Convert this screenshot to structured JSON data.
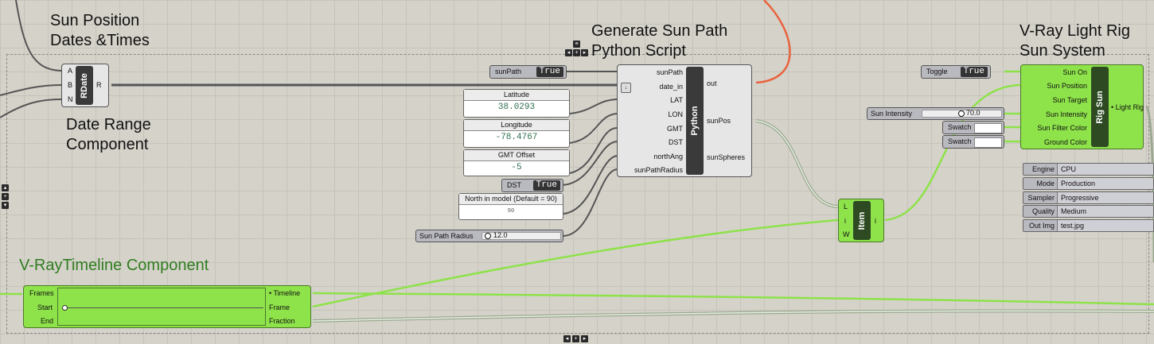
{
  "labels": {
    "sun_position": "Sun Position\nDates &Times",
    "date_range": "Date Range\nComponent",
    "generate_sun_path": "Generate Sun Path\nPython Script",
    "vray_light_rig": "V-Ray Light Rig\nSun System",
    "vray_timeline": "V-RayTimeline Component"
  },
  "rdate": {
    "name": "RDate",
    "inputs": [
      "A",
      "B",
      "N"
    ],
    "outputs": [
      "R"
    ]
  },
  "toggle_sunpath": {
    "name": "sunPath",
    "value": "True"
  },
  "toggle_dst": {
    "name": "DST",
    "value": "True"
  },
  "toggle_sun": {
    "name": "Toggle",
    "value": "True"
  },
  "panel_lat": {
    "header": "Latitude",
    "value": "38.0293"
  },
  "panel_lon": {
    "header": "Longitude",
    "value": "-78.4767"
  },
  "panel_gmt": {
    "header": "GMT Offset",
    "value": "-5"
  },
  "panel_north": {
    "header": "North in model (Default = 90)",
    "value": "90"
  },
  "slider_sunpath_radius": {
    "name": "Sun Path Radius",
    "value": "12.0"
  },
  "slider_sun_intensity": {
    "name": "Sun Intensity",
    "value": "70.0"
  },
  "python": {
    "name": "Python",
    "inputs": [
      "sunPath",
      "date_in",
      "LAT",
      "LON",
      "GMT",
      "DST",
      "northAng",
      "sunPathRadius"
    ],
    "outputs": [
      "out",
      "sunPos",
      "sunSpheres"
    ]
  },
  "item": {
    "name": "Item",
    "inputs": [
      "L",
      "i",
      "W"
    ],
    "outputs": [
      "i"
    ]
  },
  "rig_sun": {
    "name": "Rig Sun",
    "inputs": [
      "Sun On",
      "Sun Position",
      "Sun Target",
      "Sun Intensity",
      "Sun Filter Color",
      "Ground Color"
    ],
    "outputs": [
      "Light Rig"
    ]
  },
  "swatch_1": {
    "name": "Swatch"
  },
  "swatch_2": {
    "name": "Swatch"
  },
  "vray_settings": [
    {
      "key": "Engine",
      "value": "CPU"
    },
    {
      "key": "Mode",
      "value": "Production"
    },
    {
      "key": "Sampler",
      "value": "Progressive"
    },
    {
      "key": "Quality",
      "value": "Medium"
    },
    {
      "key": "Out Img",
      "value": "test.jpg"
    }
  ],
  "timeline": {
    "inputs": [
      "Frames",
      "Start",
      "End"
    ],
    "outputs": [
      "Timeline",
      "Frame",
      "Fraction"
    ]
  },
  "colors": {
    "canvas": "#d5d2ca",
    "green_component": "#8ee24a",
    "wire_green": "#8ee24a",
    "wire_red": "#e8643e",
    "wire_dark": "#555555"
  }
}
